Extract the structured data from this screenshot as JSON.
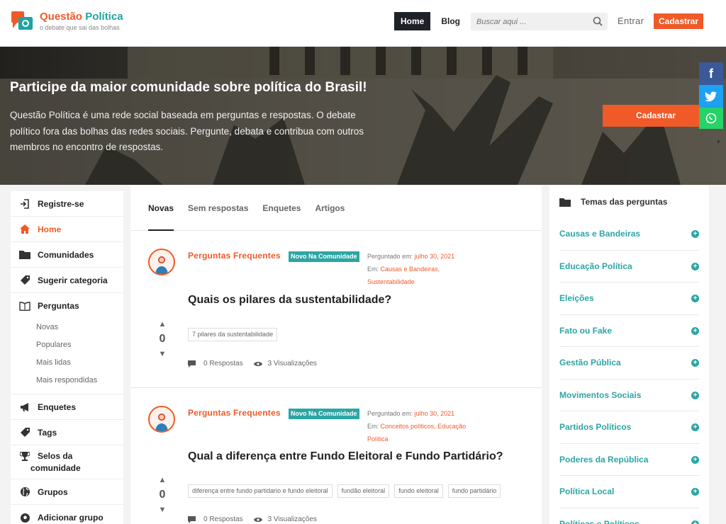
{
  "header": {
    "logo_title_a": "Questão ",
    "logo_title_b": "Política",
    "logo_tagline": "o debate que sai das bolhas",
    "nav": [
      {
        "label": "Home"
      },
      {
        "label": "Blog"
      }
    ],
    "search_placeholder": "Buscar aqui ...",
    "login_label": "Entrar",
    "signup_label": "Cadastrar"
  },
  "hero": {
    "title": "Participe da maior comunidade sobre política do Brasil!",
    "description": "Questão Política é uma rede social baseada em perguntas e respostas. O debate político fora das bolhas das redes sociais. Pergunte, debata e contribua com outros membros no encontro de respostas.",
    "cta_label": "Cadastrar",
    "social": [
      "facebook-icon",
      "twitter-icon",
      "whatsapp-icon"
    ]
  },
  "sidebar": {
    "items": [
      {
        "label": "Registre-se",
        "icon": "signin-icon"
      },
      {
        "label": "Home",
        "icon": "home-icon"
      },
      {
        "label": "Comunidades",
        "icon": "folder-icon"
      },
      {
        "label": "Sugerir categoria",
        "icon": "tag-icon"
      },
      {
        "label": "Perguntas",
        "icon": "book-icon"
      }
    ],
    "questions_sub": [
      "Novas",
      "Populares",
      "Mais lidas",
      "Mais respondidas"
    ],
    "items2": [
      {
        "label": "Enquetes",
        "icon": "megaphone-icon"
      },
      {
        "label": "Tags",
        "icon": "tags-icon"
      },
      {
        "label": "Selos da comunidade",
        "icon": "trophy-icon"
      },
      {
        "label": "Grupos",
        "icon": "globe-icon"
      },
      {
        "label": "Adicionar grupo",
        "icon": "soccer-icon"
      }
    ],
    "selos_line1": "Selos da",
    "selos_line2": "comunidade"
  },
  "tabs": [
    {
      "label": "Novas"
    },
    {
      "label": "Sem respostas"
    },
    {
      "label": "Enquetes"
    },
    {
      "label": "Artigos"
    }
  ],
  "questions": [
    {
      "author": "Perguntas Frequentes",
      "badge": "Novo Na Comunidade",
      "asked_label": "Perguntado em:",
      "asked_date": "julho 30, 2021",
      "in_label": "Em:",
      "categories_line1": "Causas e Bandeiras,",
      "categories_line2": "Sustentabilidade",
      "title": "Quais os pilares da sustentabilidade?",
      "tags": [
        "7 pilares da sustentabilidade"
      ],
      "votes": "0",
      "answers": "0 Respostas",
      "views": "3 Visualizações"
    },
    {
      "author": "Perguntas Frequentes",
      "badge": "Novo Na Comunidade",
      "asked_label": "Perguntado em:",
      "asked_date": "julho 30, 2021",
      "in_label": "Em:",
      "categories_line1": "Conceitos políticos, Educação",
      "categories_line2": "Política",
      "title": "Qual a diferença entre Fundo Eleitoral e Fundo Partidário?",
      "tags": [
        "diferença entre fundo partidario e fundo eleitoral",
        "fundão eleitoral",
        "fundo eleitoral",
        "fundo partidário"
      ],
      "votes": "0",
      "answers": "0 Respostas",
      "views": "3 Visualizações"
    }
  ],
  "right_sidebar": {
    "title": "Temas das perguntas",
    "items": [
      "Causas e Bandeiras",
      "Educação Política",
      "Eleições",
      "Fato ou Fake",
      "Gestão Pública",
      "Movimentos Sociais",
      "Partidos Políticos",
      "Poderes da República",
      "Política Local",
      "Políticas e Políticos"
    ]
  },
  "colors": {
    "accent": "#f05a28",
    "teal": "#2ca6a4",
    "dark": "#1f2128"
  }
}
